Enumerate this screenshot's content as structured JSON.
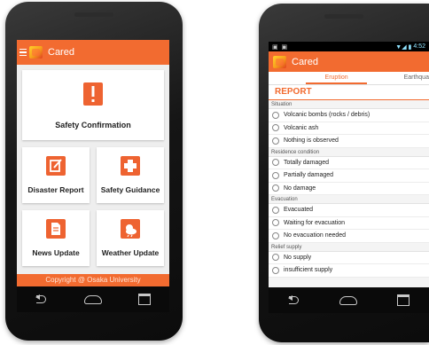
{
  "phone1": {
    "app_title": "Cared",
    "tiles": {
      "safety_confirmation": "Safety Confirmation",
      "disaster_report": "Disaster Report",
      "safety_guidance": "Safety Guidance",
      "news_update": "News Update",
      "weather_update": "Weather Update"
    },
    "footer": "Copyright @ Osaka University"
  },
  "phone2": {
    "status_time": "4:52",
    "app_title": "Cared",
    "tabs": [
      "Eruption",
      "Earthqua"
    ],
    "report_title": "REPORT",
    "sections": [
      {
        "title": "Situation",
        "options": [
          "Volcanic bombs (rocks / debris)",
          "Volcanic ash",
          "Nothing is observed"
        ]
      },
      {
        "title": "Residence condition",
        "options": [
          "Totally damaged",
          "Partially damaged",
          "No damage"
        ]
      },
      {
        "title": "Evacuation",
        "options": [
          "Evacuated",
          "Waiting for evacuation",
          "No evacuation needed"
        ]
      },
      {
        "title": "Relief supply",
        "options": [
          "No supply",
          "insufficient supply"
        ]
      }
    ]
  },
  "colors": {
    "accent": "#f26b30",
    "tile_icon": "#ee6331"
  }
}
